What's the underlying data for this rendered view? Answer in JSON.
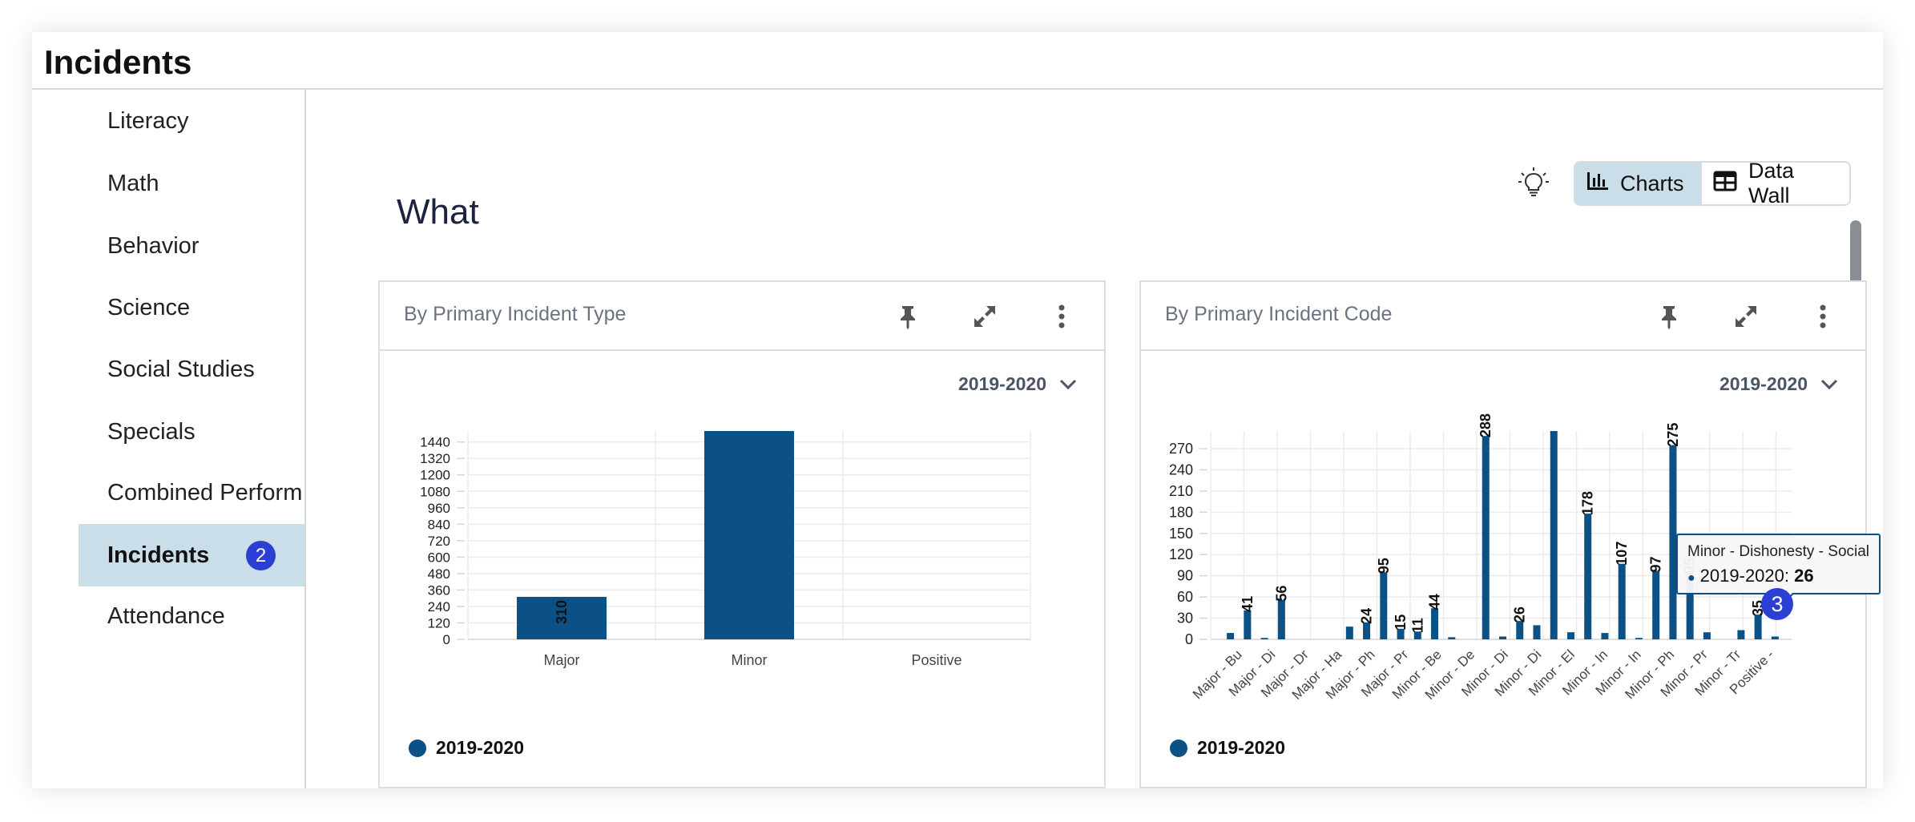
{
  "header": {
    "title": "Incidents"
  },
  "sidebar": {
    "items": [
      {
        "label": "Literacy"
      },
      {
        "label": "Math"
      },
      {
        "label": "Behavior"
      },
      {
        "label": "Science"
      },
      {
        "label": "Social Studies"
      },
      {
        "label": "Specials"
      },
      {
        "label": "Combined Perform"
      },
      {
        "label": "Incidents",
        "active": true,
        "badge": "2"
      },
      {
        "label": "Attendance"
      }
    ]
  },
  "toolbar": {
    "bulb_icon": "lightbulb-icon",
    "charts_label": "Charts",
    "charts_icon": "bar-chart-icon",
    "datawall_label": "Data Wall",
    "datawall_icon": "table-icon"
  },
  "main": {
    "section_title": "What"
  },
  "card_actions": {
    "pin_icon": "pin-icon",
    "expand_icon": "expand-icon",
    "more_icon": "more-vertical-icon"
  },
  "cards": [
    {
      "title": "By Primary Incident Type",
      "year": "2019-2020",
      "legend": "2019-2020"
    },
    {
      "title": "By Primary Incident Code",
      "year": "2019-2020",
      "legend": "2019-2020"
    }
  ],
  "tooltip": {
    "title": "Minor - Dishonesty - Social",
    "series": "2019-2020:",
    "value": "26"
  },
  "step_marker": "3",
  "colors": {
    "bar": "#0b5185",
    "accent": "#c9dee8",
    "badge": "#2b3fd4",
    "grid": "#ebebeb",
    "axis": "#d6d6d6"
  },
  "chart_data": [
    {
      "type": "bar",
      "title": "By Primary Incident Type",
      "categories": [
        "Major",
        "Minor",
        "Positive"
      ],
      "series": [
        {
          "name": "2019-2020",
          "values": [
            310,
            1520,
            0
          ]
        }
      ],
      "data_labels": [
        "310",
        "",
        ""
      ],
      "yticks": [
        0,
        120,
        240,
        360,
        480,
        600,
        720,
        840,
        960,
        1080,
        1200,
        1320,
        1440
      ],
      "ylim": [
        0,
        1520
      ],
      "grid": true,
      "legend": "bottom-left"
    },
    {
      "type": "bar",
      "title": "By Primary Incident Code",
      "categories": [
        "Major - Bu",
        "Major - Di",
        "Major - Dr",
        "Major - Ha",
        "Major - Ph",
        "Major - Pr",
        "Minor - Be",
        "Minor - De",
        "Minor - Di",
        "Minor - Di",
        "Minor - El",
        "Minor - In",
        "Minor - In",
        "Minor - Ph",
        "Minor - Pr",
        "Minor - Tr",
        "Positive -"
      ],
      "series": [
        {
          "name": "2019-2020",
          "values": [
            9,
            41,
            2,
            56,
            0,
            0,
            0,
            18,
            24,
            95,
            15,
            11,
            44,
            3,
            0,
            288,
            4,
            26,
            20,
            310,
            10,
            178,
            9,
            107,
            2,
            97,
            275,
            95,
            10,
            0,
            13,
            35,
            4
          ]
        }
      ],
      "data_labels": [
        "",
        "41",
        "",
        "56",
        "",
        "",
        "",
        "",
        "24",
        "95",
        "15",
        "11",
        "44",
        "",
        "",
        "288",
        "",
        "26",
        "",
        "",
        "",
        "178",
        "",
        "107",
        "",
        "97",
        "275",
        "95",
        "",
        "",
        "",
        "35",
        ""
      ],
      "yticks": [
        0,
        30,
        60,
        90,
        120,
        150,
        180,
        210,
        240,
        270
      ],
      "ylim": [
        0,
        295
      ],
      "grid": true,
      "legend": "bottom-left"
    }
  ]
}
